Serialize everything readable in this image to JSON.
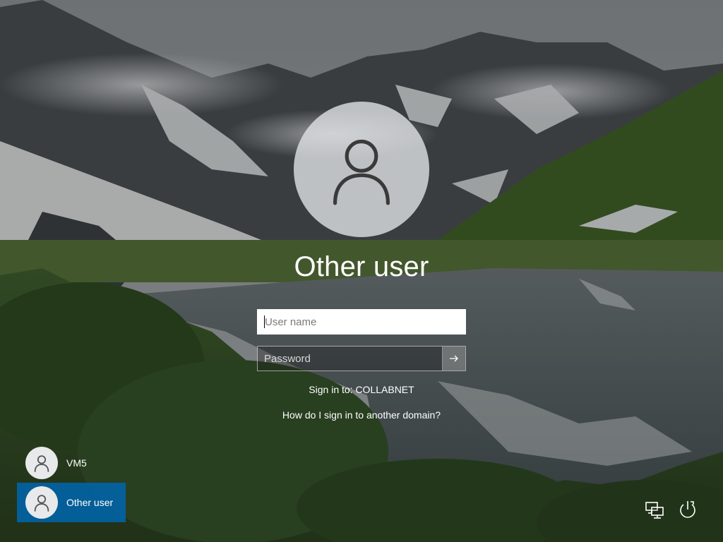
{
  "lock_screen": {
    "background_scene": "mountain-lake-landscape",
    "accent_color": "#0064aa"
  },
  "signin": {
    "display_name": "Other user",
    "avatar_icon": "person-icon",
    "username": {
      "placeholder": "User name",
      "value": ""
    },
    "password": {
      "placeholder": "Password",
      "value": "",
      "submit_icon": "arrow-right-icon"
    },
    "signin_to": "Sign in to: COLLABNET",
    "domain_help_link": "How do I sign in to another domain?"
  },
  "user_list": [
    {
      "name": "VM5",
      "selected": false
    },
    {
      "name": "Other user",
      "selected": true
    }
  ],
  "tray": {
    "network_icon": "network-icon",
    "power_icon": "power-icon"
  }
}
